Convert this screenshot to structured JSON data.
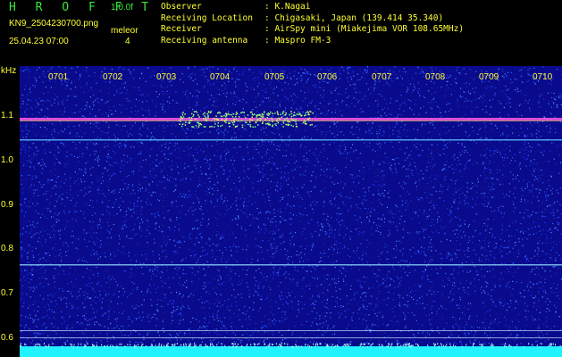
{
  "header": {
    "logo": "H R O F F T",
    "version": "1.0.0f",
    "file_name": "KN9_2504230700.png",
    "mode": "meleor",
    "date": "25.04.23 07:00",
    "count": "4",
    "info": [
      {
        "key": "Observer",
        "value": ": K.Nagai"
      },
      {
        "key": "Receiving Location",
        "value": ": Chigasaki, Japan (139.414 35.340)"
      },
      {
        "key": "Receiver",
        "value": ": AirSpy mini (Miakejima VOR 108.65MHz)"
      },
      {
        "key": "Receiving antenna",
        "value": ": Maspro FM-3"
      }
    ]
  },
  "spectrogram": {
    "y_unit": "kHz",
    "y_ticks": [
      "1.1",
      "1.0",
      "0.9",
      "0.8",
      "0.7",
      "0.6"
    ],
    "x_ticks": [
      "0701",
      "0702",
      "0703",
      "0704",
      "0705",
      "0706",
      "0707",
      "0708",
      "0709",
      "0710"
    ],
    "colors": {
      "background": "#000000",
      "noise_base": "#0a0a8c",
      "carrier": "#ff5ce0",
      "label": "#ffff33",
      "logo": "#39e639"
    }
  }
}
